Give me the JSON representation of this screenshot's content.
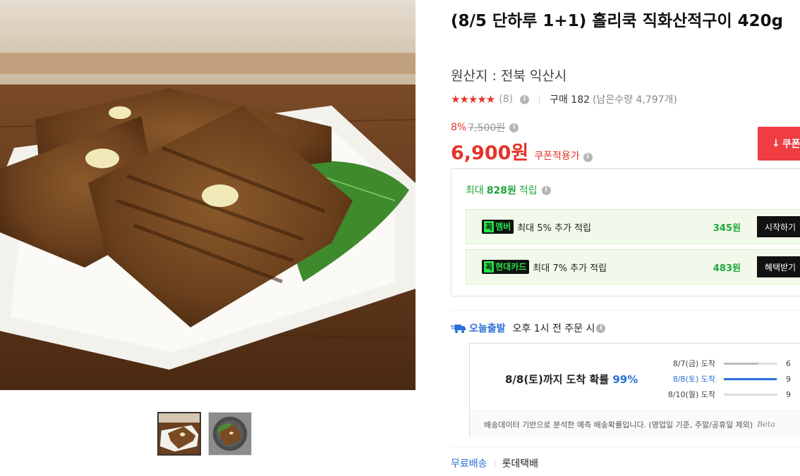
{
  "product": {
    "title": "(8/5 단하루 1+1) 홀리쿡 직화산적구이 420g",
    "origin": "원산지 : 전북 익산시"
  },
  "rating": {
    "stars": "★★★★★",
    "review_count": "(8)",
    "purchase_label": "구매 182",
    "stock_label": "(남은수량 4,797개)"
  },
  "price": {
    "discount_rate": "8%",
    "original": "7,500원",
    "sale": "6,900원",
    "coupon_label": "쿠폰적용가",
    "coupon_button": "쿠폰"
  },
  "reward": {
    "head_prefix": "최대",
    "head_amount": "828원",
    "head_suffix": "적립",
    "rows": [
      {
        "badge_ggok": "꼭",
        "badge": "멤버",
        "desc": "최대 5% 추가 적립",
        "amount": "345원",
        "button": "시작하기"
      },
      {
        "badge_ggok": "꼭",
        "badge": "현대카드",
        "desc": "최대 7% 추가 적립",
        "amount": "483원",
        "button": "혜택받기"
      }
    ]
  },
  "shipping": {
    "today": "오늘출발",
    "condition": "오후 1시 전 주문 시",
    "forecast_main": "8/8(토)까지 도착 확률",
    "forecast_pct": "99%",
    "forecast_list": [
      {
        "label": "8/7(금) 도착",
        "value": 0.64,
        "val_text": "6"
      },
      {
        "label": "8/8(토) 도착",
        "value": 0.99,
        "val_text": "9",
        "selected": true
      },
      {
        "label": "8/10(월) 도착",
        "value": 0.0,
        "val_text": "9"
      }
    ],
    "note": "배송데이터 기반으로 분석한 예측 배송확률입니다. (영업일 기준, 주말/공휴일 제외)",
    "beta": "Beta",
    "free": "무료배송",
    "courier": "롯데택배"
  },
  "icons": {
    "info": "info-icon",
    "truck": "truck-icon",
    "download": "download-icon"
  },
  "colors": {
    "accent_red": "#e5332a",
    "coupon_red": "#ef3d42",
    "reward_green": "#1fa53e",
    "ship_blue": "#2a6fd6"
  }
}
